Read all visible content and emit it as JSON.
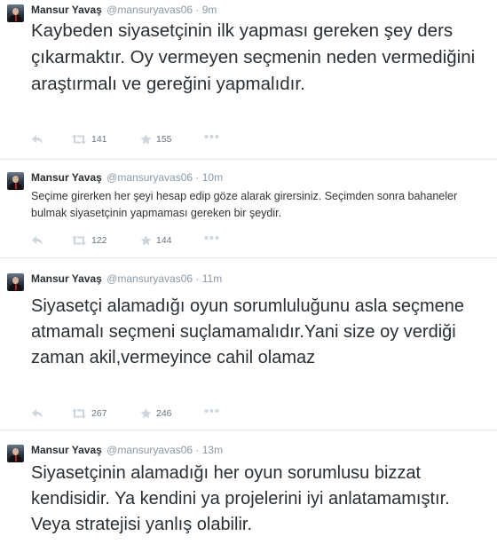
{
  "tweets": [
    {
      "name": "Mansur Yavaş",
      "handle": "@mansuryavas06",
      "dot": "·",
      "time": "9m",
      "text": "Kaybeden siyasetçinin ilk yapması gereken şey ders çıkarmaktır. Oy vermeyen seçmenin neden vermediğini araştırmalı ve gereğini yapmalıdır.",
      "retweets": "141",
      "favorites": "155"
    },
    {
      "name": "Mansur Yavaş",
      "handle": "@mansuryavas06",
      "dot": "·",
      "time": "10m",
      "text": "Seçime girerken her şeyi hesap edip göze alarak girersiniz. Seçimden sonra bahaneler bulmak siyasetçinin yapmaması gereken bir şeydir.",
      "retweets": "122",
      "favorites": "144"
    },
    {
      "name": "Mansur Yavaş",
      "handle": "@mansuryavas06",
      "dot": "·",
      "time": "11m",
      "text": "Siyasetçi alamadığı oyun sorumluluğunu asla seçmene atmamalı seçmeni suçlamamalıdır.Yani size oy verdiği zaman akil,vermeyince cahil olamaz",
      "retweets": "267",
      "favorites": "246"
    },
    {
      "name": "Mansur Yavaş",
      "handle": "@mansuryavas06",
      "dot": "·",
      "time": "13m",
      "text": "Siyasetçinin alamadığı her oyun sorumlusu bizzat kendisidir. Ya kendini ya projelerini iyi anlatamamıştır. Veya stratejisi yanlış olabilir."
    }
  ],
  "icons": {
    "reply": "reply-icon",
    "retweet": "retweet-icon",
    "favorite": "star-icon",
    "more": "more-dots-icon"
  },
  "colors": {
    "text": "#292f33",
    "meta": "#8899a6",
    "icon": "#ccd6dd",
    "divider": "#e1e8ed"
  }
}
